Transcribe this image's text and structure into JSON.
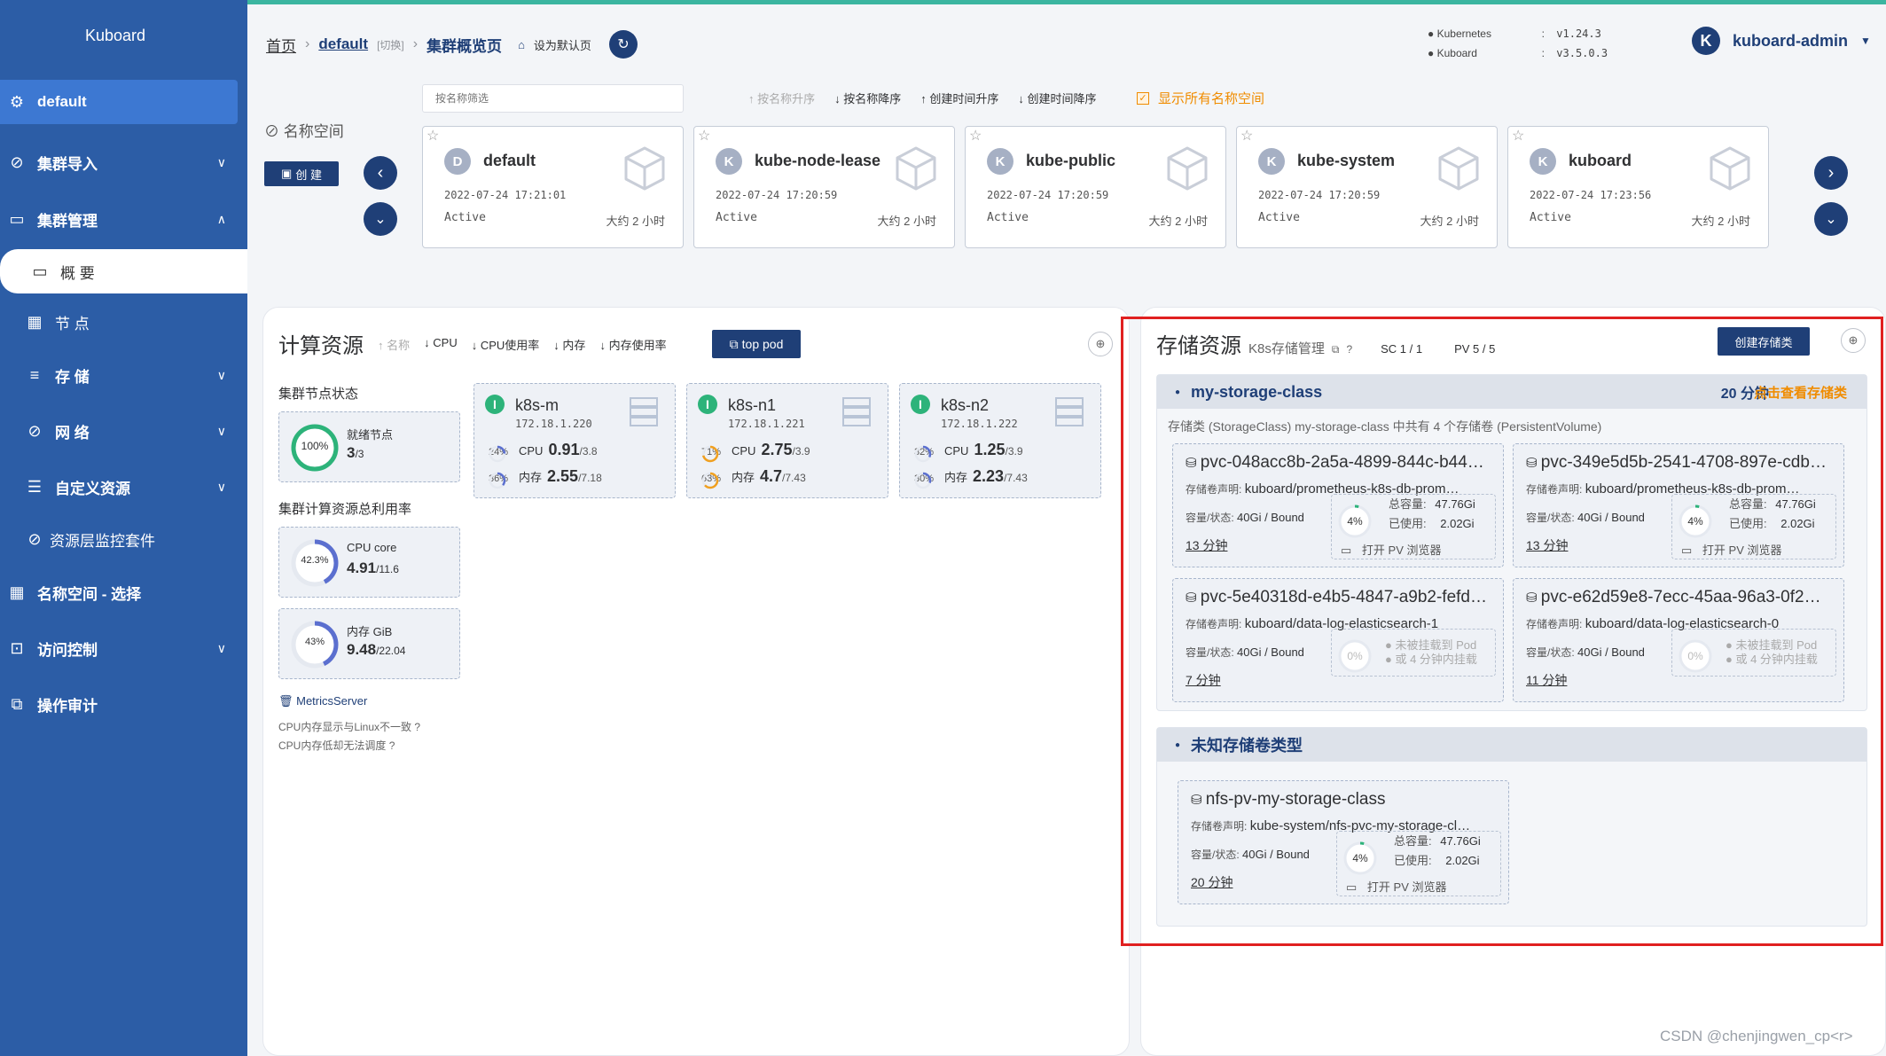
{
  "sidebar": {
    "title": "Kuboard",
    "namespace": "default",
    "items": [
      {
        "label": "集群导入",
        "icon": "link-icon"
      },
      {
        "label": "集群管理",
        "icon": "monitor-icon"
      },
      {
        "label": "概 要",
        "icon": "screen-icon"
      },
      {
        "label": "节 点",
        "icon": "grid-icon"
      },
      {
        "label": "存 储",
        "icon": "database-icon"
      },
      {
        "label": "网 络",
        "icon": "network-icon"
      },
      {
        "label": "自定义资源",
        "icon": "sliders-icon"
      },
      {
        "label": "资源层监控套件",
        "icon": "paperclip-icon"
      },
      {
        "label": "名称空间 - 选择",
        "icon": "grid-icon"
      },
      {
        "label": "访问控制",
        "icon": "lock-icon"
      },
      {
        "label": "操作审计",
        "icon": "audit-icon"
      }
    ]
  },
  "header": {
    "home": "首页",
    "cluster": "default",
    "switch": "[切换]",
    "page": "集群概览页",
    "set_default": "设为默认页",
    "versions": [
      {
        "name": "Kubernetes",
        "value": "v1.24.3"
      },
      {
        "name": "Kuboard",
        "value": "v3.5.0.3"
      }
    ],
    "user": "kuboard-admin",
    "user_initial": "K"
  },
  "ns_bar": {
    "filter_placeholder": "按名称筛选",
    "sorts": [
      "按名称升序",
      "按名称降序",
      "创建时间升序",
      "创建时间降序"
    ],
    "show_all": "显示所有名称空间",
    "label": "名称空间",
    "create": "创 建",
    "namespaces": [
      {
        "initial": "D",
        "name": "default",
        "created": "2022-07-24 17:21:01",
        "status": "Active",
        "age": "大约 2 小时"
      },
      {
        "initial": "K",
        "name": "kube-node-lease",
        "created": "2022-07-24 17:20:59",
        "status": "Active",
        "age": "大约 2 小时"
      },
      {
        "initial": "K",
        "name": "kube-public",
        "created": "2022-07-24 17:20:59",
        "status": "Active",
        "age": "大约 2 小时"
      },
      {
        "initial": "K",
        "name": "kube-system",
        "created": "2022-07-24 17:20:59",
        "status": "Active",
        "age": "大约 2 小时"
      },
      {
        "initial": "K",
        "name": "kuboard",
        "created": "2022-07-24 17:23:56",
        "status": "Active",
        "age": "大约 2 小时"
      }
    ]
  },
  "compute": {
    "title": "计算资源",
    "sorts": [
      "名称",
      "CPU",
      "CPU使用率",
      "内存",
      "内存使用率"
    ],
    "top_pod": "top pod",
    "node_status_label": "集群节点状态",
    "ready_label": "就绪节点",
    "ready_pct": "100%",
    "ready_value": "3",
    "ready_total": "/3",
    "usage_label": "集群计算资源总利用率",
    "cpu_label": "CPU core",
    "cpu_pct": "42.3%",
    "cpu_value": "4.91",
    "cpu_total": "/11.6",
    "mem_label": "内存 GiB",
    "mem_pct": "43%",
    "mem_value": "9.48",
    "mem_total": "/22.04",
    "metrics_server": "MetricsServer",
    "note1": "CPU内存显示与Linux不一致",
    "note2": "CPU内存低却无法调度",
    "nodes": [
      {
        "name": "k8s-m",
        "ip": "172.18.1.220",
        "cpu_pct": "24%",
        "cpu": "0.91",
        "cpu_total": "/3.8",
        "mem_pct": "36%",
        "mem": "2.55",
        "mem_total": "/7.18"
      },
      {
        "name": "k8s-n1",
        "ip": "172.18.1.221",
        "cpu_pct": "71%",
        "cpu": "2.75",
        "cpu_total": "/3.9",
        "mem_pct": "63%",
        "mem": "4.7",
        "mem_total": "/7.43"
      },
      {
        "name": "k8s-n2",
        "ip": "172.18.1.222",
        "cpu_pct": "32%",
        "cpu": "1.25",
        "cpu_total": "/3.9",
        "mem_pct": "30%",
        "mem": "2.23",
        "mem_total": "/7.43"
      }
    ],
    "cpu_word": "CPU",
    "mem_word": "内存"
  },
  "storage": {
    "title": "存储资源",
    "k8s_link": "K8s存储管理",
    "sc": "SC 1 / 1",
    "pv": "PV 5 / 5",
    "create_sc": "创建存储类",
    "class_name": "my-storage-class",
    "class_age": "20 分钟",
    "view_class": "点击查看存储类",
    "class_desc": "存储类 (StorageClass) my-storage-class 中共有 4 个存储卷 (PersistentVolume)",
    "claim_label": "存储卷声明:",
    "cap_label": "容量/状态:",
    "total_label": "总容量:",
    "used_label": "已使用:",
    "open_browser": "打开 PV 浏览器",
    "not_mounted_1": "未被挂载到 Pod",
    "not_mounted_2": "或 4 分钟内挂载",
    "pvcs": [
      {
        "name": "pvc-048acc8b-2a5a-4899-844c-b44c…",
        "claim": "kuboard/prometheus-k8s-db-prom…",
        "cap": "40Gi / Bound",
        "age": "13 分钟",
        "mounted": true,
        "pct": "4%",
        "total": "47.76Gi",
        "used": "2.02Gi"
      },
      {
        "name": "pvc-349e5d5b-2541-4708-897e-cdbc…",
        "claim": "kuboard/prometheus-k8s-db-prom…",
        "cap": "40Gi / Bound",
        "age": "13 分钟",
        "mounted": true,
        "pct": "4%",
        "total": "47.76Gi",
        "used": "2.02Gi"
      },
      {
        "name": "pvc-5e40318d-e4b5-4847-a9b2-fefd…",
        "claim": "kuboard/data-log-elasticsearch-1",
        "cap": "40Gi / Bound",
        "age": "7 分钟",
        "mounted": false,
        "pct": "0%"
      },
      {
        "name": "pvc-e62d59e8-7ecc-45aa-96a3-0f27…",
        "claim": "kuboard/data-log-elasticsearch-0",
        "cap": "40Gi / Bound",
        "age": "11 分钟",
        "mounted": false,
        "pct": "0%"
      }
    ],
    "unknown_title": "未知存储卷类型",
    "nfs": {
      "name": "nfs-pv-my-storage-class",
      "claim": "kube-system/nfs-pvc-my-storage-cl…",
      "cap": "40Gi / Bound",
      "age": "20 分钟",
      "pct": "4%",
      "total": "47.76Gi",
      "used": "2.02Gi"
    }
  },
  "watermark": "CSDN @chenjingwen_cp<r>",
  "colors": {
    "sidebar": "#2c5da6",
    "accent": "#1f3f77",
    "highlight": "#e02020",
    "orange": "#f08c00",
    "green": "#2db37a"
  }
}
